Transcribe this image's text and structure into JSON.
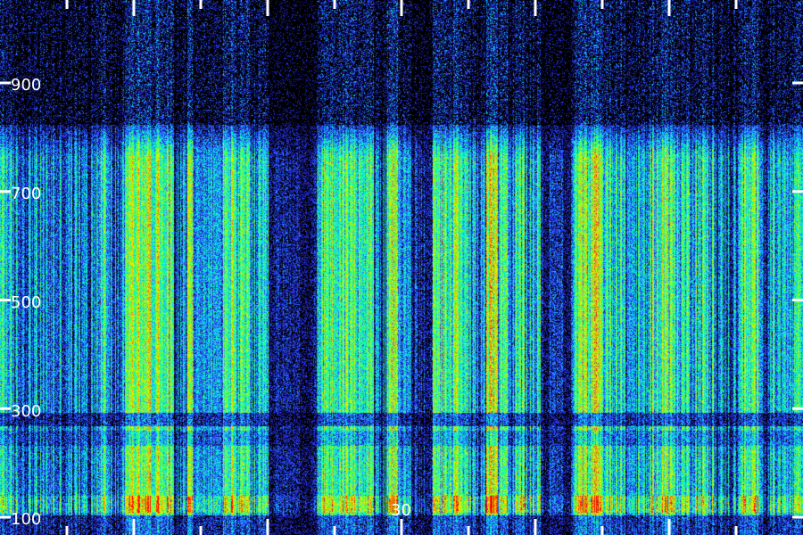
{
  "chart_data": {
    "type": "heatmap",
    "title": "",
    "xlabel": "",
    "ylabel": "",
    "y_ticks": [
      {
        "value": 100,
        "label": "100"
      },
      {
        "value": 300,
        "label": "300"
      },
      {
        "value": 500,
        "label": "500"
      },
      {
        "value": 700,
        "label": "700"
      },
      {
        "value": 900,
        "label": "900"
      }
    ],
    "ylim": [
      100,
      1000
    ],
    "x_ticks": [
      {
        "value": 30,
        "label": "30"
      }
    ],
    "colormap": [
      "#000000",
      "#1a1aa0",
      "#2b3cff",
      "#1fb8ff",
      "#00ffd0",
      "#3cff50",
      "#c8ff00",
      "#ffe000",
      "#ff7000",
      "#ff0000"
    ],
    "tick_color": "#ffffff",
    "background": "#000000"
  }
}
